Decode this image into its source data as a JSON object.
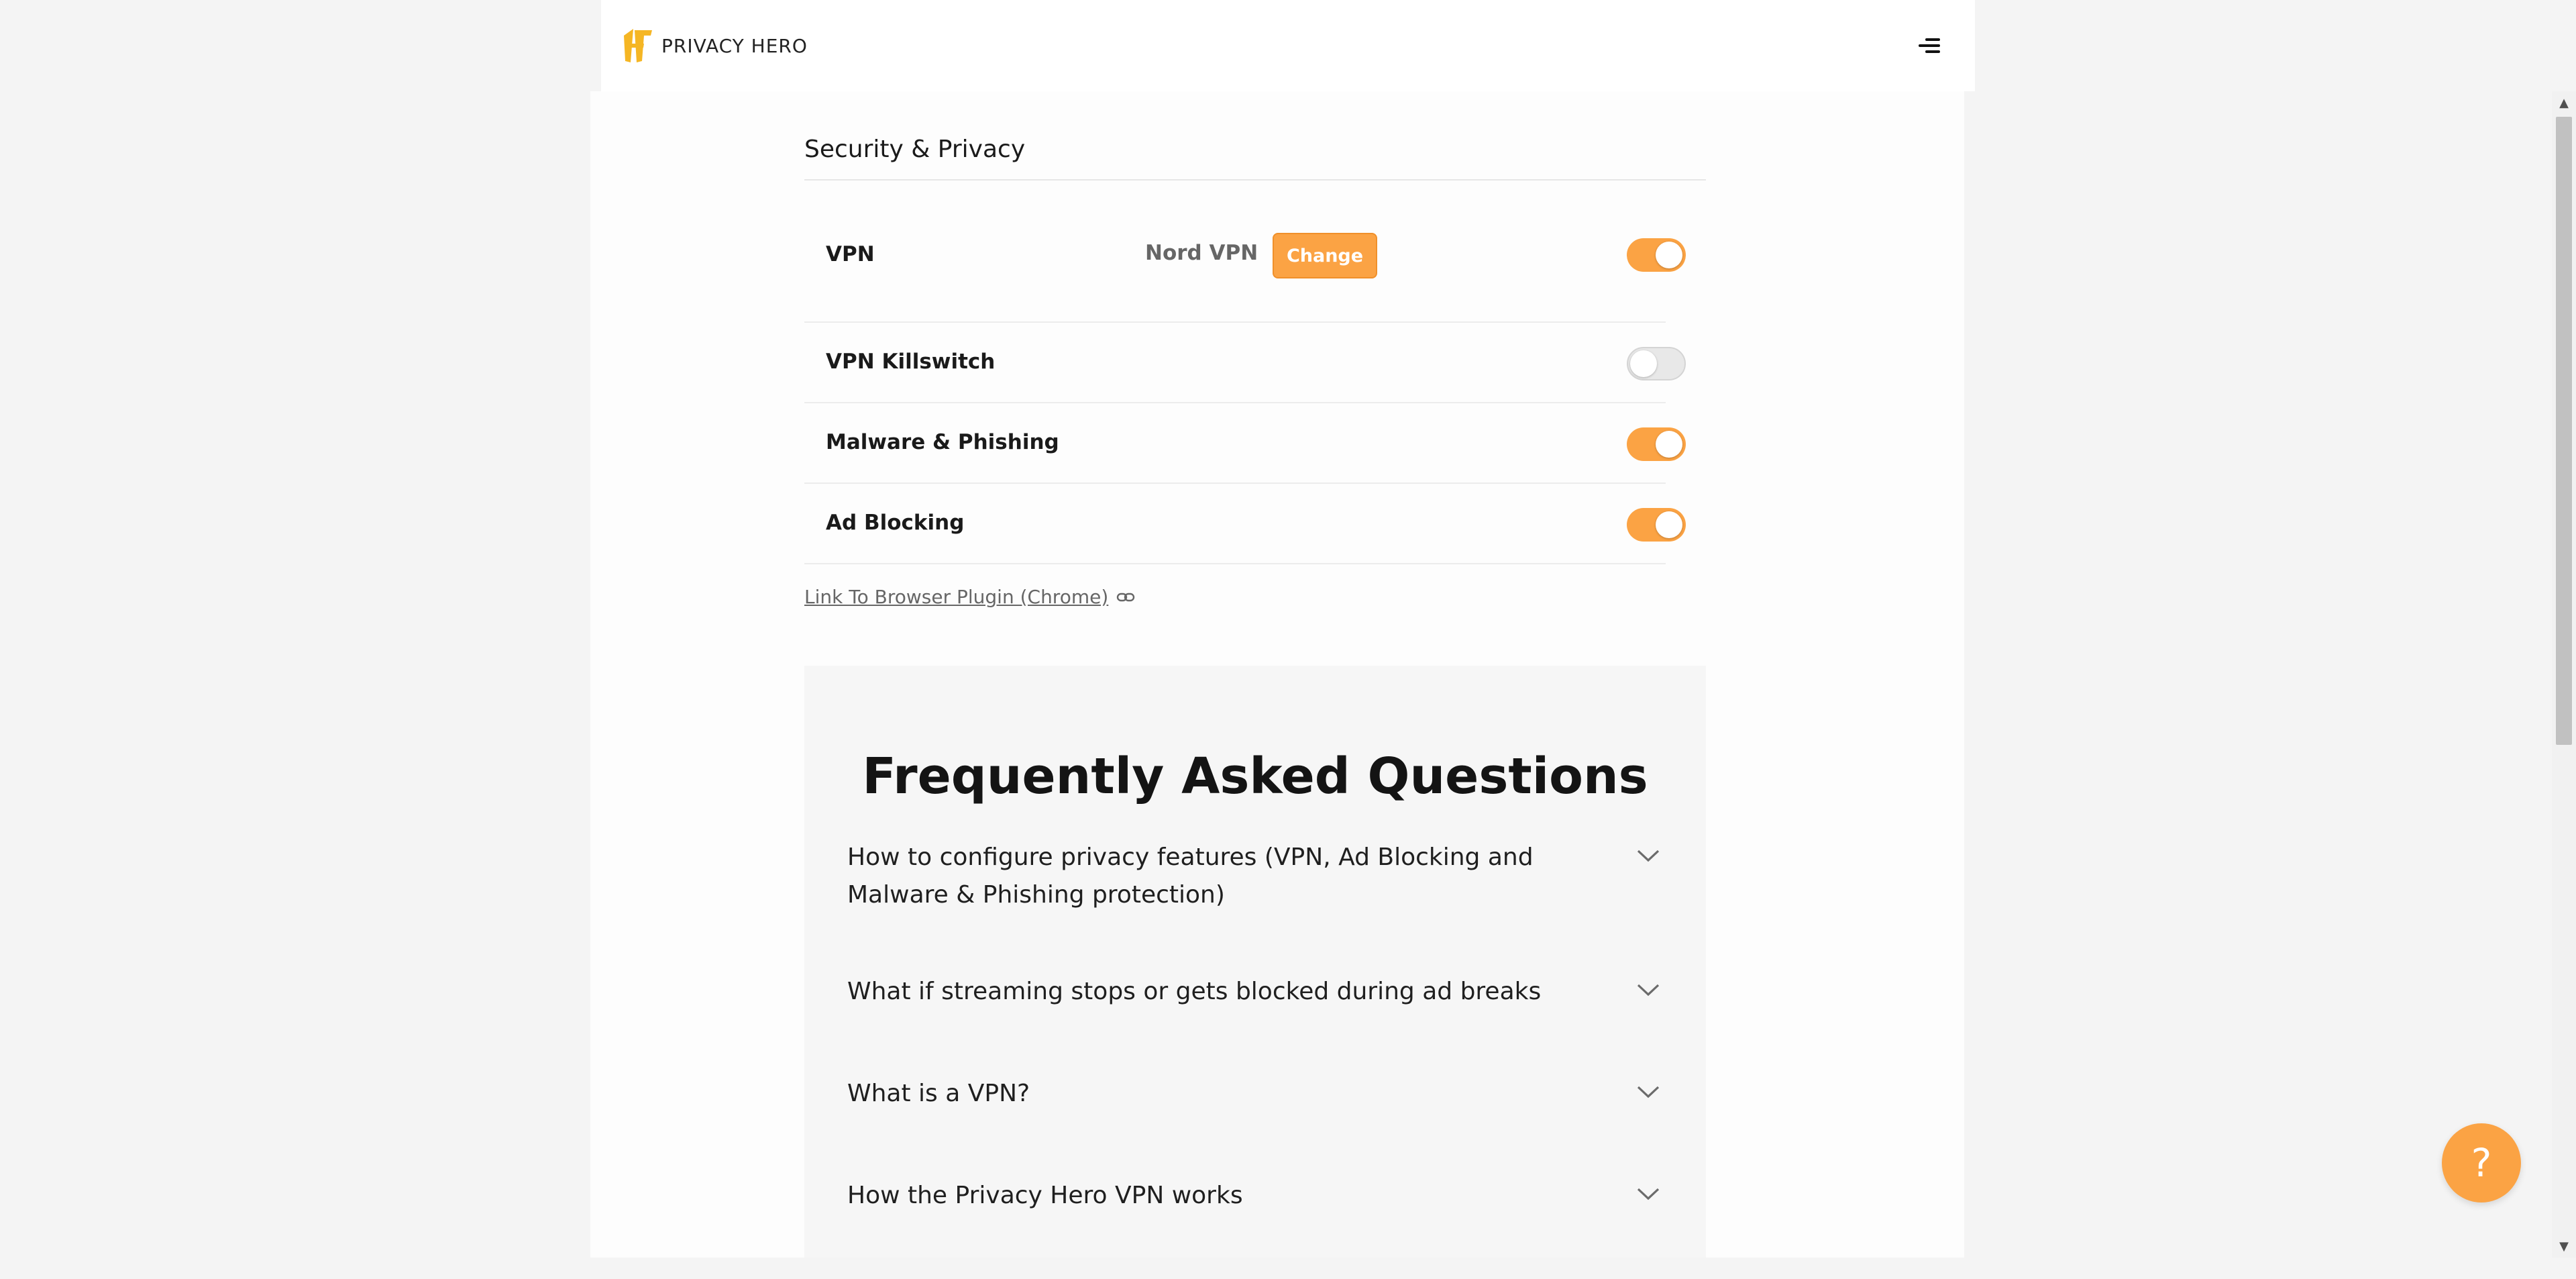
{
  "header": {
    "logo_text": "PRIVACY HERO",
    "menu_icon": "hamburger-menu-icon"
  },
  "settings": {
    "title": "Security & Privacy",
    "vpn": {
      "label": "VPN",
      "provider": "Nord VPN",
      "change_label": "Change",
      "enabled": true
    },
    "killswitch": {
      "label": "VPN Killswitch",
      "enabled": false
    },
    "malware": {
      "label": "Malware & Phishing",
      "enabled": true
    },
    "adblock": {
      "label": "Ad Blocking",
      "enabled": true
    },
    "plugin_link": "Link To Browser Plugin (Chrome)",
    "plugin_link_icon": "link-icon"
  },
  "faq": {
    "title": "Frequently Asked Questions",
    "items": [
      {
        "question": "How to configure privacy features (VPN, Ad Blocking and Malware & Phishing protection)"
      },
      {
        "question": "What if streaming stops or gets blocked during ad breaks"
      },
      {
        "question": "What is a VPN?"
      },
      {
        "question": "How the Privacy Hero VPN works"
      }
    ],
    "chevron_icon": "chevron-down-icon"
  },
  "help": {
    "label": "?",
    "icon": "help-icon"
  },
  "colors": {
    "accent": "#fba344",
    "toggle_off": "#e8e8e8",
    "page_background": "#f4f4f4"
  },
  "scrollbar": {
    "up_arrow": "▲",
    "down_arrow": "▼"
  }
}
